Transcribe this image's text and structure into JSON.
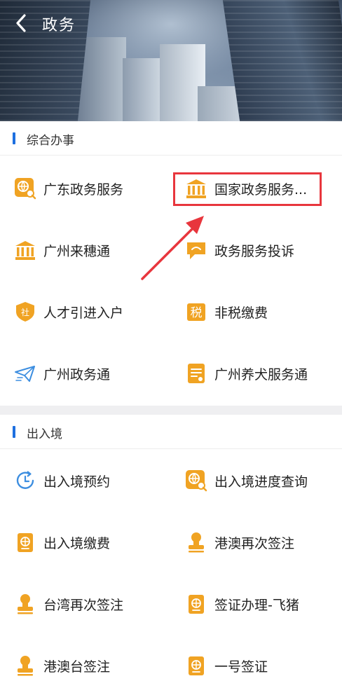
{
  "header": {
    "title": "政务"
  },
  "sections": [
    {
      "title": "综合办事",
      "items": [
        {
          "label": "广东政务服务",
          "icon": "globe-search-icon"
        },
        {
          "label": "国家政务服务...",
          "icon": "government-building-icon"
        },
        {
          "label": "广州来穗通",
          "icon": "government-building-icon"
        },
        {
          "label": "政务服务投诉",
          "icon": "speech-bubble-icon"
        },
        {
          "label": "人才引进入户",
          "icon": "shield-badge-icon"
        },
        {
          "label": "非税缴费",
          "icon": "tax-character-icon"
        },
        {
          "label": "广州政务通",
          "icon": "paper-plane-icon"
        },
        {
          "label": "广州养犬服务通",
          "icon": "document-icon"
        }
      ]
    },
    {
      "title": "出入境",
      "items": [
        {
          "label": "出入境预约",
          "icon": "clock-refresh-icon"
        },
        {
          "label": "出入境进度查询",
          "icon": "globe-search-icon"
        },
        {
          "label": "出入境缴费",
          "icon": "passport-icon"
        },
        {
          "label": "港澳再次签注",
          "icon": "stamp-icon"
        },
        {
          "label": "台湾再次签注",
          "icon": "stamp-icon"
        },
        {
          "label": "签证办理-飞猪",
          "icon": "passport-icon"
        },
        {
          "label": "港澳台签注",
          "icon": "stamp-icon"
        },
        {
          "label": "一号签证",
          "icon": "passport-icon"
        }
      ]
    }
  ],
  "colors": {
    "accent": "#1d6fe0",
    "icon": "#f0a323",
    "highlight": "#e8363d"
  }
}
